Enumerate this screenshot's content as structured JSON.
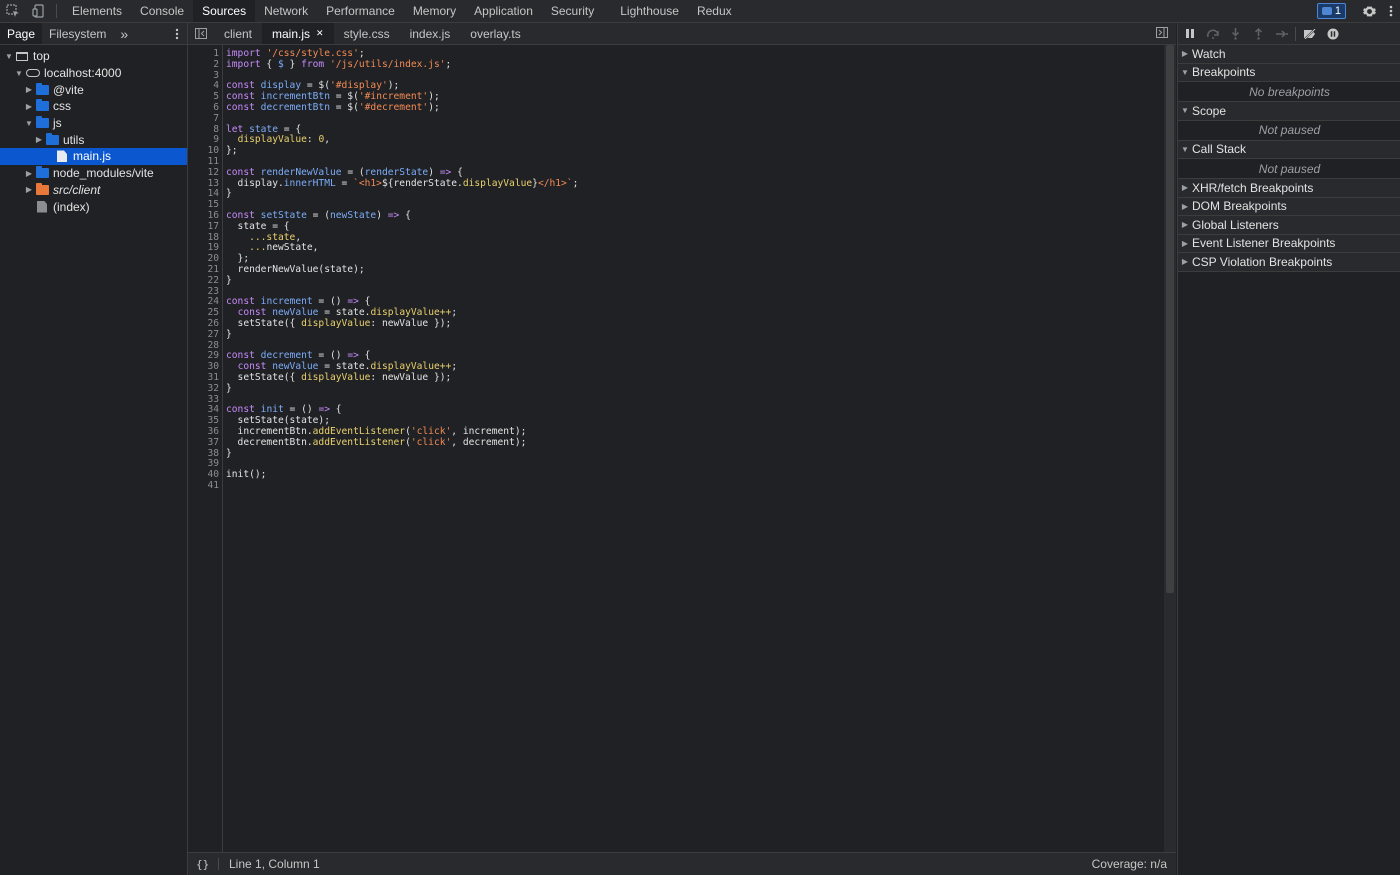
{
  "toolbar": {
    "tabs": [
      {
        "label": "Elements",
        "active": false
      },
      {
        "label": "Console",
        "active": false
      },
      {
        "label": "Sources",
        "active": true
      },
      {
        "label": "Network",
        "active": false
      },
      {
        "label": "Performance",
        "active": false
      },
      {
        "label": "Memory",
        "active": false
      },
      {
        "label": "Application",
        "active": false
      },
      {
        "label": "Security",
        "active": false
      },
      {
        "label": "Lighthouse",
        "active": false
      },
      {
        "label": "Redux",
        "active": false
      }
    ],
    "issues_count": "1"
  },
  "navigator": {
    "tabs": [
      {
        "label": "Page",
        "active": true
      },
      {
        "label": "Filesystem",
        "active": false
      }
    ],
    "more": "»",
    "tree": [
      {
        "label": "top",
        "kind": "frame",
        "expanded": true
      },
      {
        "label": "localhost:4000",
        "kind": "cloud",
        "expanded": true
      },
      {
        "label": "@vite",
        "kind": "folder",
        "expanded": false
      },
      {
        "label": "css",
        "kind": "folder",
        "expanded": false
      },
      {
        "label": "js",
        "kind": "folder",
        "expanded": true
      },
      {
        "label": "utils",
        "kind": "folder",
        "expanded": false
      },
      {
        "label": "main.js",
        "kind": "file",
        "selected": true
      },
      {
        "label": "node_modules/vite",
        "kind": "folder",
        "expanded": false
      },
      {
        "label": "src/client",
        "kind": "folder-orange",
        "expanded": false
      },
      {
        "label": "(index)",
        "kind": "file-grey"
      }
    ]
  },
  "editor": {
    "tabs": [
      {
        "label": "client",
        "active": false
      },
      {
        "label": "main.js",
        "active": true,
        "closable": true
      },
      {
        "label": "style.css",
        "active": false
      },
      {
        "label": "index.js",
        "active": false
      },
      {
        "label": "overlay.ts",
        "active": false
      }
    ],
    "lines": [
      [
        [
          "kw",
          "import"
        ],
        [
          "plain",
          " "
        ],
        [
          "str",
          "'/css/style.css'"
        ],
        [
          "plain",
          ";"
        ]
      ],
      [
        [
          "kw",
          "import"
        ],
        [
          "plain",
          " { "
        ],
        [
          "var",
          "$"
        ],
        [
          "plain",
          " } "
        ],
        [
          "kw",
          "from"
        ],
        [
          "plain",
          " "
        ],
        [
          "str",
          "'/js/utils/index.js'"
        ],
        [
          "plain",
          ";"
        ]
      ],
      [],
      [
        [
          "kw",
          "const"
        ],
        [
          "plain",
          " "
        ],
        [
          "var",
          "display"
        ],
        [
          "plain",
          " = $("
        ],
        [
          "str",
          "'#display'"
        ],
        [
          "plain",
          ");"
        ]
      ],
      [
        [
          "kw",
          "const"
        ],
        [
          "plain",
          " "
        ],
        [
          "var",
          "incrementBtn"
        ],
        [
          "plain",
          " = $("
        ],
        [
          "str",
          "'#increment'"
        ],
        [
          "plain",
          ");"
        ]
      ],
      [
        [
          "kw",
          "const"
        ],
        [
          "plain",
          " "
        ],
        [
          "var",
          "decrementBtn"
        ],
        [
          "plain",
          " = $("
        ],
        [
          "str",
          "'#decrement'"
        ],
        [
          "plain",
          ");"
        ]
      ],
      [],
      [
        [
          "kw",
          "let"
        ],
        [
          "plain",
          " "
        ],
        [
          "var",
          "state"
        ],
        [
          "plain",
          " = {"
        ]
      ],
      [
        [
          "plain",
          "  "
        ],
        [
          "ylw",
          "displayValue"
        ],
        [
          "plain",
          ": "
        ],
        [
          "num",
          "0"
        ],
        [
          "plain",
          ","
        ]
      ],
      [
        [
          "plain",
          "};"
        ]
      ],
      [],
      [
        [
          "kw",
          "const"
        ],
        [
          "plain",
          " "
        ],
        [
          "var",
          "renderNewValue"
        ],
        [
          "plain",
          " = ("
        ],
        [
          "var",
          "renderState"
        ],
        [
          "plain",
          ") "
        ],
        [
          "kw",
          "=>"
        ],
        [
          "plain",
          " {"
        ]
      ],
      [
        [
          "plain",
          "  display."
        ],
        [
          "prop",
          "innerHTML"
        ],
        [
          "plain",
          " = "
        ],
        [
          "str",
          "`<h1>"
        ],
        [
          "plain",
          "${renderState."
        ],
        [
          "ylw",
          "displayValue"
        ],
        [
          "plain",
          "}"
        ],
        [
          "str",
          "</h1>`"
        ],
        [
          "plain",
          ";"
        ]
      ],
      [
        [
          "plain",
          "}"
        ]
      ],
      [],
      [
        [
          "kw",
          "const"
        ],
        [
          "plain",
          " "
        ],
        [
          "var",
          "setState"
        ],
        [
          "plain",
          " = ("
        ],
        [
          "var",
          "newState"
        ],
        [
          "plain",
          ") "
        ],
        [
          "kw",
          "=>"
        ],
        [
          "plain",
          " {"
        ]
      ],
      [
        [
          "plain",
          "  state = {"
        ]
      ],
      [
        [
          "plain",
          "    "
        ],
        [
          "ylw",
          "...state"
        ],
        [
          "plain",
          ","
        ]
      ],
      [
        [
          "plain",
          "    "
        ],
        [
          "ylw",
          "..."
        ],
        [
          "plain",
          "newState,"
        ]
      ],
      [
        [
          "plain",
          "  };"
        ]
      ],
      [
        [
          "plain",
          "  renderNewValue(state);"
        ]
      ],
      [
        [
          "plain",
          "}"
        ]
      ],
      [],
      [
        [
          "kw",
          "const"
        ],
        [
          "plain",
          " "
        ],
        [
          "var",
          "increment"
        ],
        [
          "plain",
          " = () "
        ],
        [
          "kw",
          "=>"
        ],
        [
          "plain",
          " {"
        ]
      ],
      [
        [
          "plain",
          "  "
        ],
        [
          "kw",
          "const"
        ],
        [
          "plain",
          " "
        ],
        [
          "var",
          "newValue"
        ],
        [
          "plain",
          " = state."
        ],
        [
          "ylw",
          "displayValue++"
        ],
        [
          "plain",
          ";"
        ]
      ],
      [
        [
          "plain",
          "  setState({ "
        ],
        [
          "ylw",
          "displayValue"
        ],
        [
          "plain",
          ": newValue });"
        ]
      ],
      [
        [
          "plain",
          "}"
        ]
      ],
      [],
      [
        [
          "kw",
          "const"
        ],
        [
          "plain",
          " "
        ],
        [
          "var",
          "decrement"
        ],
        [
          "plain",
          " = () "
        ],
        [
          "kw",
          "=>"
        ],
        [
          "plain",
          " {"
        ]
      ],
      [
        [
          "plain",
          "  "
        ],
        [
          "kw",
          "const"
        ],
        [
          "plain",
          " "
        ],
        [
          "var",
          "newValue"
        ],
        [
          "plain",
          " = state."
        ],
        [
          "ylw",
          "displayValue++"
        ],
        [
          "plain",
          ";"
        ]
      ],
      [
        [
          "plain",
          "  setState({ "
        ],
        [
          "ylw",
          "displayValue"
        ],
        [
          "plain",
          ": newValue });"
        ]
      ],
      [
        [
          "plain",
          "}"
        ]
      ],
      [],
      [
        [
          "kw",
          "const"
        ],
        [
          "plain",
          " "
        ],
        [
          "var",
          "init"
        ],
        [
          "plain",
          " = () "
        ],
        [
          "kw",
          "=>"
        ],
        [
          "plain",
          " {"
        ]
      ],
      [
        [
          "plain",
          "  setState(state);"
        ]
      ],
      [
        [
          "plain",
          "  incrementBtn."
        ],
        [
          "ylw",
          "addEventListener"
        ],
        [
          "plain",
          "("
        ],
        [
          "str",
          "'click'"
        ],
        [
          "plain",
          ", increment);"
        ]
      ],
      [
        [
          "plain",
          "  decrementBtn."
        ],
        [
          "ylw",
          "addEventListener"
        ],
        [
          "plain",
          "("
        ],
        [
          "str",
          "'click'"
        ],
        [
          "plain",
          ", decrement);"
        ]
      ],
      [
        [
          "plain",
          "}"
        ]
      ],
      [],
      [
        [
          "plain",
          "init();"
        ]
      ],
      []
    ],
    "status_position": "Line 1, Column 1",
    "coverage": "Coverage: n/a",
    "format_icon": "{}"
  },
  "debugger": {
    "sections": [
      {
        "label": "Watch",
        "expanded": false
      },
      {
        "label": "Breakpoints",
        "expanded": true,
        "placeholder": "No breakpoints"
      },
      {
        "label": "Scope",
        "expanded": true,
        "placeholder": "Not paused"
      },
      {
        "label": "Call Stack",
        "expanded": true,
        "placeholder": "Not paused"
      },
      {
        "label": "XHR/fetch Breakpoints",
        "expanded": false
      },
      {
        "label": "DOM Breakpoints",
        "expanded": false
      },
      {
        "label": "Global Listeners",
        "expanded": false
      },
      {
        "label": "Event Listener Breakpoints",
        "expanded": false
      },
      {
        "label": "CSP Violation Breakpoints",
        "expanded": false
      }
    ]
  },
  "colors": {
    "accent": "#0b57d0",
    "keyword": "#c58af9",
    "string": "#f28b54",
    "variable": "#7cacf8",
    "yellow": "#e9d16c"
  }
}
